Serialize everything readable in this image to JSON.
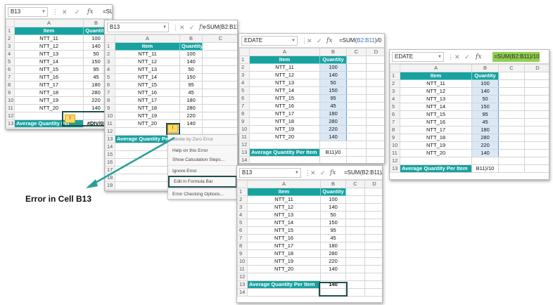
{
  "data_rows": [
    {
      "row": "2",
      "item": "NTT_11",
      "qty": "100"
    },
    {
      "row": "3",
      "item": "NTT_12",
      "qty": "140"
    },
    {
      "row": "4",
      "item": "NTT_13",
      "qty": "50"
    },
    {
      "row": "5",
      "item": "NTT_14",
      "qty": "150"
    },
    {
      "row": "6",
      "item": "NTT_15",
      "qty": "95"
    },
    {
      "row": "7",
      "item": "NTT_16",
      "qty": "45"
    },
    {
      "row": "8",
      "item": "NTT_17",
      "qty": "180"
    },
    {
      "row": "9",
      "item": "NTT_18",
      "qty": "280"
    },
    {
      "row": "10",
      "item": "NTT_19",
      "qty": "220"
    },
    {
      "row": "11",
      "item": "NTT_20",
      "qty": "140"
    }
  ],
  "header_row": {
    "row": "1",
    "item": "Item",
    "qty": "Quantity"
  },
  "avg_label": "Average Quantity Per Item",
  "avg_label_short": "Average Quantity Per",
  "column_letters": {
    "a": "A",
    "b": "B",
    "c": "C",
    "d": "D"
  },
  "icons": {
    "cancel": "✕",
    "enter": "✓",
    "fx": "fx",
    "more": "⋮"
  },
  "panel1": {
    "namebox": "B13",
    "formula": "=SUM(B2:B11)/0",
    "result": "#DIV/0!",
    "last_row": "12",
    "avg_row": "13"
  },
  "panel2": {
    "namebox": "B13",
    "formula": "=SUM(B2:B11)/0",
    "result": "#DIV/0!",
    "extra_rows": [
      "12",
      "13",
      "14",
      "15",
      "16",
      "17",
      "18",
      "19",
      "20",
      "21"
    ]
  },
  "panel3": {
    "namebox": "EDATE",
    "formula_prefix": "=SUM(",
    "formula_ref": "B2:B11",
    "formula_suffix": ")/0",
    "edit_text": "B11)/0",
    "rows_after": [
      "12",
      "13",
      "14"
    ]
  },
  "panel4": {
    "namebox": "EDATE",
    "formula": "=SUM(B2:B11)/10",
    "edit_text": "B11)/10",
    "rows_after": [
      "12",
      "13"
    ]
  },
  "panel5": {
    "namebox": "B13",
    "formula": "=SUM(B2:B11)/10",
    "result": "140",
    "rows_after": [
      "12",
      "13",
      "14"
    ]
  },
  "context_menu": {
    "title": "Divide by Zero Error",
    "items": [
      "Help on this Error",
      "Show Calculation Steps...",
      "Ignore Error",
      "Edit in Formula Bar",
      "Error Checking Options..."
    ]
  },
  "caption": "Error in Cell B13",
  "colors": {
    "header": "#17a2a0",
    "highlight_border": "#1f4e4d",
    "arrow": "#2a9d9a",
    "formula_select": "#92d050"
  }
}
